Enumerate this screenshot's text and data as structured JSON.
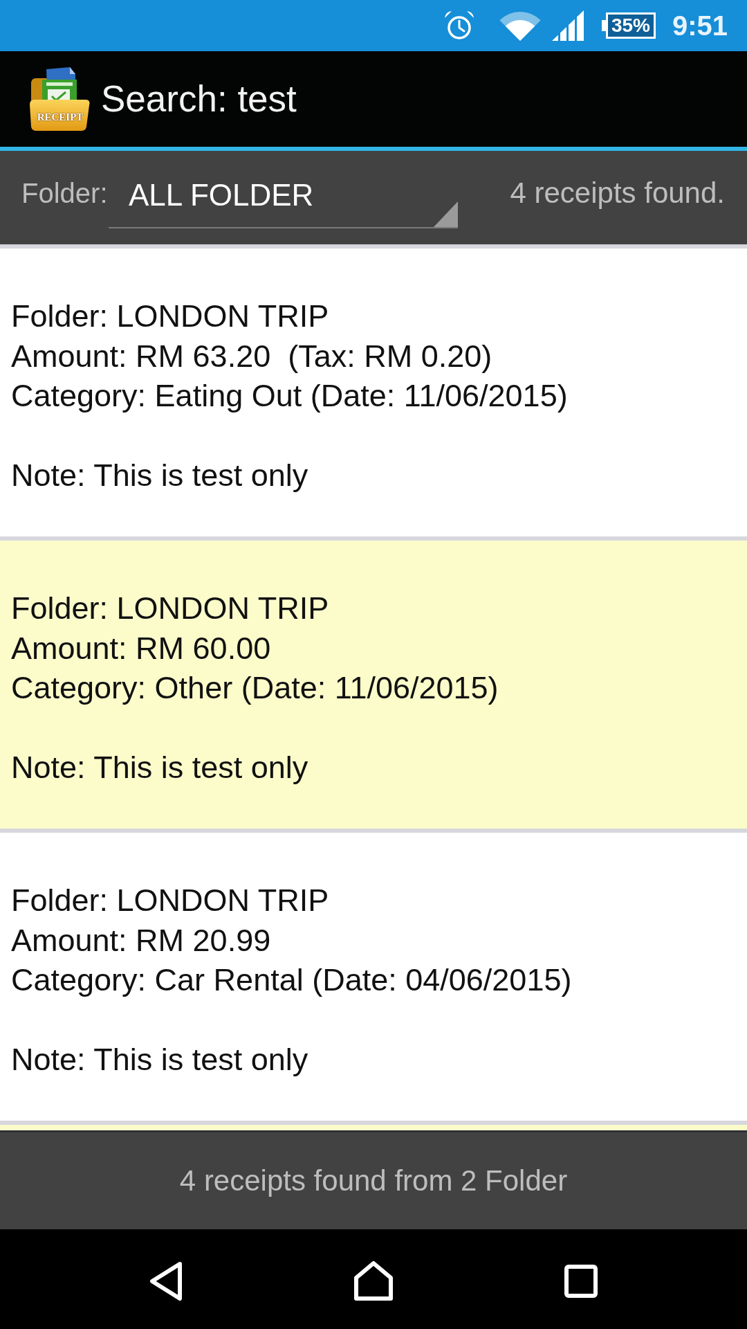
{
  "status_bar": {
    "battery": "35%",
    "time": "9:51"
  },
  "action_bar": {
    "logo_text": "RECEIPT",
    "title": "Search: test"
  },
  "filter_bar": {
    "label": "Folder:",
    "folder": "ALL FOLDER",
    "result_count": "4 receipts found."
  },
  "receipts": [
    {
      "folder": "Folder: LONDON TRIP",
      "amount": "Amount: RM 63.20  (Tax: RM 0.20)",
      "category": "Category: Eating Out (Date: 11/06/2015)",
      "note": "Note: This is test only"
    },
    {
      "folder": "Folder: LONDON TRIP",
      "amount": "Amount: RM 60.00",
      "category": "Category: Other (Date: 11/06/2015)",
      "note": "Note: This is test only"
    },
    {
      "folder": "Folder: LONDON TRIP",
      "amount": "Amount: RM 20.99",
      "category": "Category: Car Rental (Date: 04/06/2015)",
      "note": "Note: This is test only"
    }
  ],
  "footer": {
    "summary": "4 receipts found from 2 Folder"
  }
}
